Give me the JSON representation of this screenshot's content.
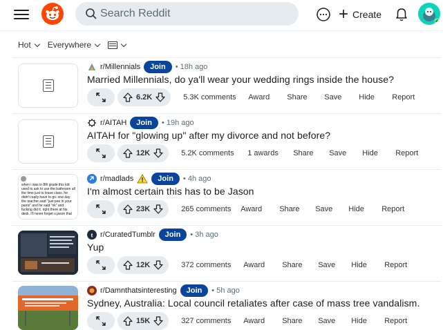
{
  "header": {
    "search_placeholder": "Search Reddit",
    "create_label": "Create"
  },
  "sortbar": {
    "sort": "Hot",
    "scope": "Everywhere"
  },
  "colors": {
    "join": "#0a449b",
    "search_bg": "#e5ebee",
    "brand": "#ff4500"
  },
  "posts": [
    {
      "subreddit": "r/Millennials",
      "join": "Join",
      "time": "• 18h ago",
      "title": "Married Millennials, do ya'll wear your wedding rings inside the house?",
      "votes": "6.2K",
      "comments": "5.3K comments",
      "award": "Award",
      "share": "Share",
      "save": "Save",
      "hide": "Hide",
      "report": "Report"
    },
    {
      "subreddit": "r/AITAH",
      "join": "Join",
      "time": "• 19h ago",
      "title": "AITAH for \"glowing up\" after my divorce and not before?",
      "votes": "12K",
      "comments": "5.2K comments",
      "award": "1 awards",
      "share": "Share",
      "save": "Save",
      "hide": "Hide",
      "report": "Report"
    },
    {
      "subreddit": "r/madlads",
      "join": "Join",
      "time": "• 4h ago",
      "title": "I'm almost certain this has to be Jason",
      "votes": "23K",
      "comments": "265 comments",
      "award": "Award",
      "share": "Share",
      "save": "Save",
      "hide": "Hide",
      "report": "Report",
      "thumb_text": "when i was in 8th grade this kid used to ask to use the bathroom all the time just to leave class. he didn't really have to go. one day the teacher said \"just pee in your pants\" and he said \"ok\" and fucking did it. right there at his desk. i'll never forget u jason that"
    },
    {
      "subreddit": "r/CuratedTumblr",
      "join": "Join",
      "time": "• 3h ago",
      "title": "Yup",
      "votes": "12K",
      "comments": "372 comments",
      "award": "Award",
      "share": "Share",
      "save": "Save",
      "hide": "Hide",
      "report": "Report"
    },
    {
      "subreddit": "r/Damnthatsinteresting",
      "join": "Join",
      "time": "• 5h ago",
      "title": "Sydney, Australia: Local council retaliates after case of mass tree vandalism.",
      "votes": "15K",
      "comments": "327 comments",
      "award": "Award",
      "share": "Share",
      "save": "Save",
      "hide": "Hide",
      "report": "Report"
    }
  ]
}
